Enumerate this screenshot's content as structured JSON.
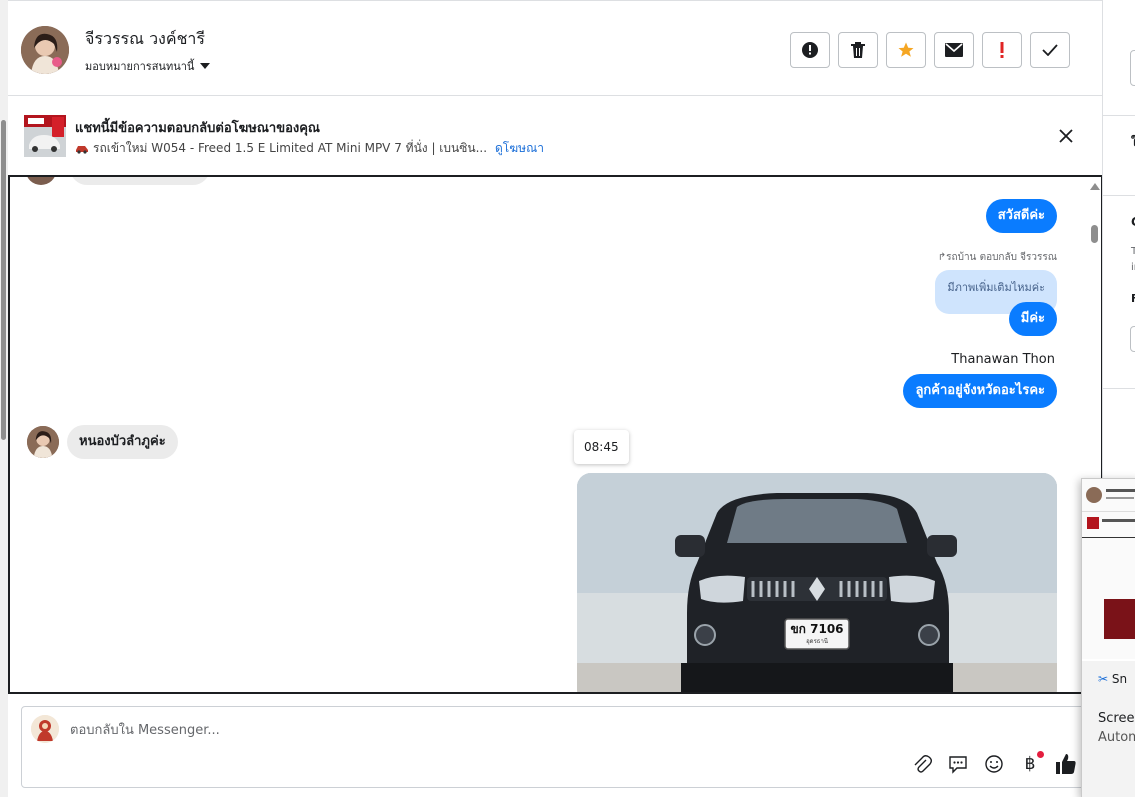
{
  "header": {
    "contact_name": "จีรวรรณ วงค์ชารี",
    "assign_label": "มอบหมายการสนทนานี้",
    "actions": [
      {
        "name": "report-icon",
        "label": "!"
      },
      {
        "name": "trash-icon"
      },
      {
        "name": "star-icon"
      },
      {
        "name": "mail-icon"
      },
      {
        "name": "exclamation-icon",
        "label": "!"
      },
      {
        "name": "check-icon"
      }
    ],
    "colors": {
      "star": "#f5a623",
      "exclamation": "#e02424"
    }
  },
  "ad_banner": {
    "title": "แชทนี้มีข้อความตอบกลับต่อโฆษณาของคุณ",
    "subtitle": "รถเข้าใหม่ W054 - Freed 1.5 E Limited AT Mini MPV 7 ที่นั่ง | เบนซิน...",
    "link": "ดูโฆษณา",
    "icon": "car-icon"
  },
  "messages": {
    "hello": "สวัสดีค่ะ",
    "reply_note": "รถบ้าน ตอบกลับ จีรวรรณ",
    "quoted": "มีภาพเพิ่มเติมไหมค่ะ",
    "yes": "มีค่ะ",
    "sender": "Thanawan Thon",
    "question": "ลูกค้าอยู่จังหวัดอะไรคะ",
    "customer_reply": "หนองบัวลำภูค่ะ",
    "timestamp": "08:45",
    "photo_plate": "ขก 7106",
    "photo_plate_sub": "อุดรธานี"
  },
  "composer": {
    "placeholder": "ตอบกลับใน Messenger...",
    "tools": [
      "paperclip-icon",
      "saved-reply-icon",
      "emoji-icon",
      "baht-icon",
      "thumbs-up-icon"
    ]
  },
  "right_panel": {
    "letters": [
      "ใ",
      "C",
      "T",
      "ir",
      "F"
    ]
  },
  "snip_popup": {
    "app": "Sn",
    "title": "Screen",
    "subtitle": "Autom"
  },
  "accent": "#0a7cff"
}
